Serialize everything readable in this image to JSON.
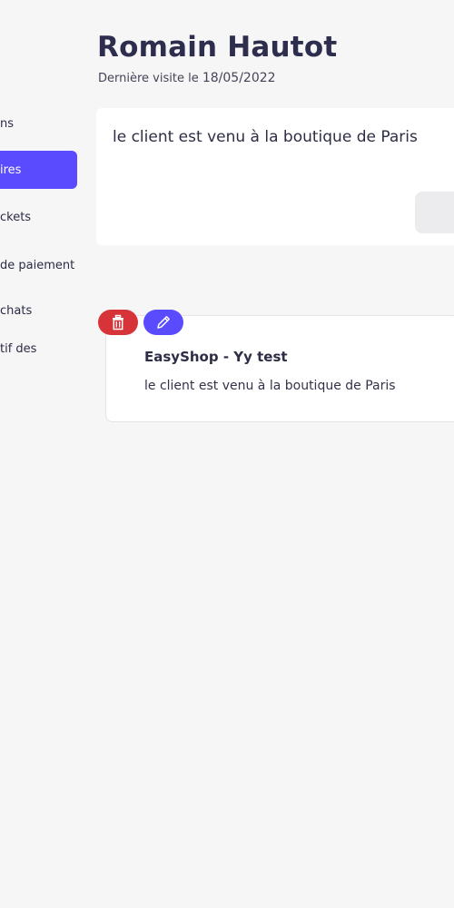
{
  "header": {
    "title": "Romain Hautot",
    "last_visit_label": "Dernière visite le",
    "last_visit_date": "18/05/2022"
  },
  "sidebar": {
    "items": [
      {
        "label": "ns",
        "active": false
      },
      {
        "label": "ires",
        "active": true
      },
      {
        "label": "ckets",
        "active": false
      },
      {
        "label": "de paiement",
        "active": false
      },
      {
        "label": "chats",
        "active": false
      },
      {
        "label": "tif des",
        "active": false
      }
    ]
  },
  "editor": {
    "text": "le client est venu à la boutique de Paris"
  },
  "notes": [
    {
      "title": "EasyShop - Yy test",
      "body": "le client est venu à la boutique de Paris"
    }
  ],
  "icons": {
    "delete": "trash-icon",
    "edit": "pencil-icon"
  },
  "colors": {
    "accent": "#5a4bff",
    "danger": "#d7343a",
    "background": "#f6f6f6"
  }
}
